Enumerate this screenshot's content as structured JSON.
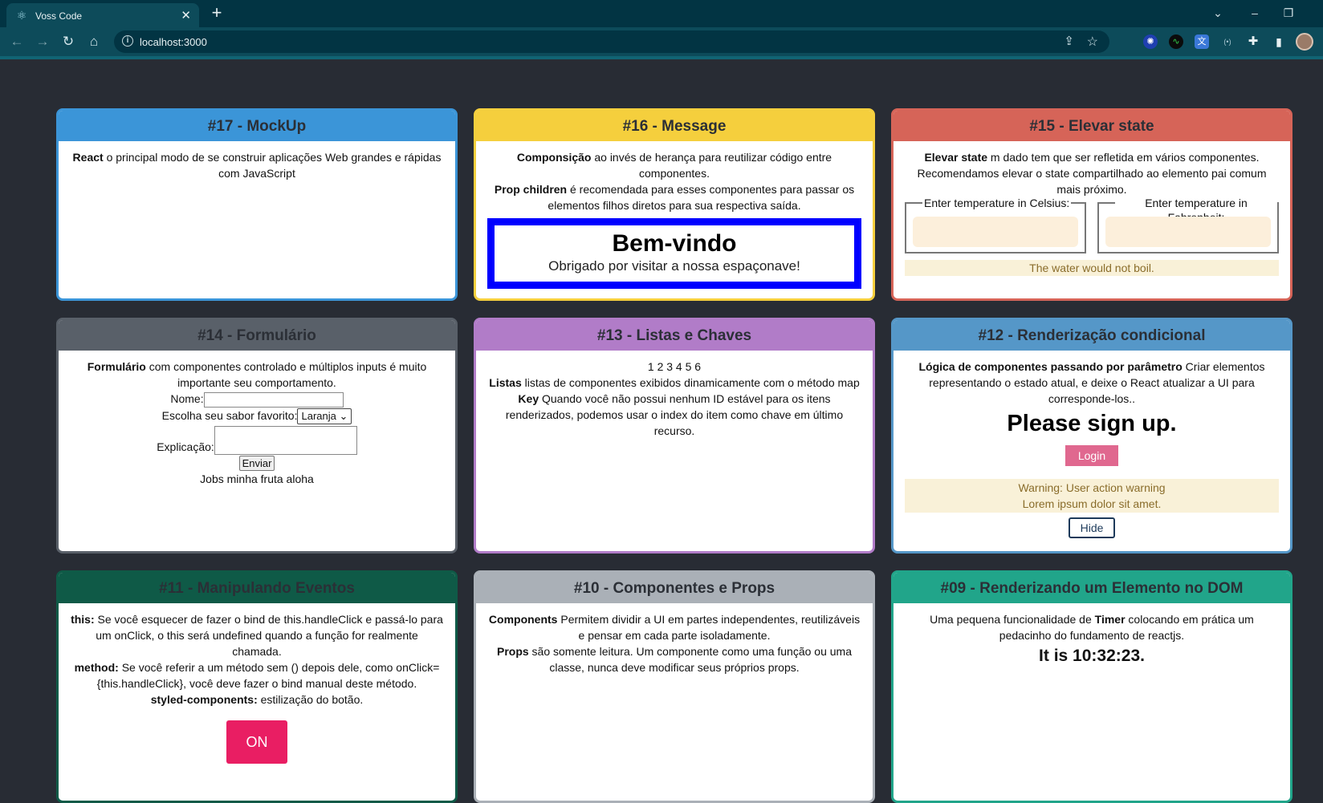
{
  "browser": {
    "tab_title": "Voss Code",
    "url": "localhost:3000"
  },
  "cards": {
    "c17": {
      "title": "#17 - MockUp",
      "b1": "React",
      "t1": " o principal modo de se construir aplicações Web grandes e rápidas com JavaScript"
    },
    "c16": {
      "title": "#16 - Message",
      "b1": "Componsição",
      "t1": " ao invés de herança para reutilizar código entre componentes.",
      "b2": "Prop children",
      "t2": " é recomendada para esses componentes para passar os elementos filhos diretos para sua respectiva saída.",
      "welcome_title": "Bem-vindo",
      "welcome_text": "Obrigado por visitar a nossa espaçonave!"
    },
    "c15": {
      "title": "#15 - Elevar state",
      "b1": "Elevar state",
      "t1": " m dado tem que ser refletida em vários componentes. Recomendamos elevar o state compartilhado ao elemento pai comum mais próximo.",
      "celsius_label": "Enter temperature in Celsius:",
      "fahrenheit_label": "Enter temperature in Fahrenheit:",
      "boil_message": "The water would not boil."
    },
    "c14": {
      "title": "#14 - Formulário",
      "b1": "Formulário",
      "t1": " com componentes controlado e múltiplos inputs é muito importante seu comportamento.",
      "name_label": "Nome:",
      "flavor_label": "Escolha seu sabor favorito:",
      "flavor_selected": "Laranja",
      "explanation_label": "Explicação:",
      "submit_label": "Enviar",
      "result_text": "Jobs minha fruta aloha"
    },
    "c13": {
      "title": "#13 - Listas e Chaves",
      "numbers": "1 2 3 4 5 6",
      "b1": "Listas",
      "t1": " listas de componentes exibidos dinamicamente com o método map",
      "b2": "Key",
      "t2": " Quando você não possui nenhum ID estável para os itens renderizados, podemos usar o index do item como chave em último recurso."
    },
    "c12": {
      "title": "#12 - Renderização condicional",
      "b1": "Lógica de componentes passando por parâmetro",
      "t1": " Criar elementos representando o estado atual, e deixe o React atualizar a UI para corresponde-los..",
      "signup": "Please sign up.",
      "login_label": "Login",
      "warning_line1": "Warning: User action warning",
      "warning_line2": "Lorem ipsum dolor sit amet.",
      "hide_label": "Hide"
    },
    "c11": {
      "title": "#11 - Manipulando Eventos",
      "b1": "this:",
      "t1": " Se você esquecer de fazer o bind de this.handleClick e passá-lo para um onClick, o this será undefined quando a função for realmente chamada.",
      "b2": "method:",
      "t2": " Se você referir a um método sem () depois dele, como onClick={this.handleClick}, você deve fazer o bind manual deste método.",
      "b3": "styled-components:",
      "t3": " estilização do botão.",
      "toggle_label": "ON"
    },
    "c10": {
      "title": "#10 - Componentes e Props",
      "b1": "Components",
      "t1": " Permitem dividir a UI em partes independentes, reutilizáveis e pensar em cada parte isoladamente.",
      "b2": "Props",
      "t2": " são somente leitura. Um componente como uma função ou uma classe, nunca deve modificar seus próprios props."
    },
    "c09": {
      "title": "#09 - Renderizando um Elemento no DOM",
      "t1a": "Uma pequena funcionalidade de ",
      "b1": "Timer",
      "t1b": " colocando em prática um pedacinho do fundamento de reactjs.",
      "clock": "It is 10:32:23."
    }
  },
  "colors": {
    "page_bg": "#282c34",
    "browser_frame": "#023443",
    "card17": "#3b95d8",
    "card16": "#f5cf3d",
    "card15": "#d66458",
    "card14": "#596069",
    "card13": "#b17cc8",
    "card12": "#5597c8",
    "card11": "#0f5a47",
    "card10": "#aab0b7",
    "card09": "#21a58a",
    "welcome_border": "#0000ff",
    "on_button": "#e91e63"
  }
}
